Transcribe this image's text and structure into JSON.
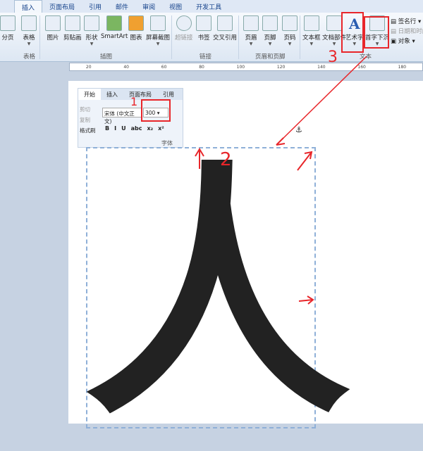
{
  "tabs": [
    "插入",
    "页面布局",
    "引用",
    "邮件",
    "审阅",
    "视图",
    "开发工具"
  ],
  "ribbon": {
    "buttons": [
      "分页",
      "表格",
      "图片",
      "剪贴画",
      "形状",
      "SmartArt",
      "图表",
      "屏幕截图",
      "超链接",
      "书签",
      "交叉引用",
      "页眉",
      "页脚",
      "页码",
      "文本框",
      "文档部件",
      "艺术字",
      "首字下沉"
    ],
    "small": [
      "签名行",
      "日期和时间",
      "对象"
    ],
    "groups": [
      "表格",
      "插图",
      "链接",
      "页眉和页脚",
      "文本"
    ]
  },
  "ruler": [
    "20",
    "40",
    "60",
    "80",
    "100",
    "120",
    "140",
    "160",
    "180"
  ],
  "inset": {
    "tabs": [
      "开始",
      "插入",
      "页面布局",
      "引用"
    ],
    "clip": [
      "剪切",
      "复制",
      "格式刷"
    ],
    "font": "宋体 (中文正文)",
    "size": "300",
    "format": [
      "B",
      "I",
      "U",
      "abc",
      "x₂",
      "x²"
    ],
    "group": "字体"
  },
  "annotations": [
    "1",
    "2",
    "3"
  ],
  "document": {
    "character": "人"
  },
  "colors": {
    "annotation": "#e8262a",
    "accent": "#15428b"
  }
}
